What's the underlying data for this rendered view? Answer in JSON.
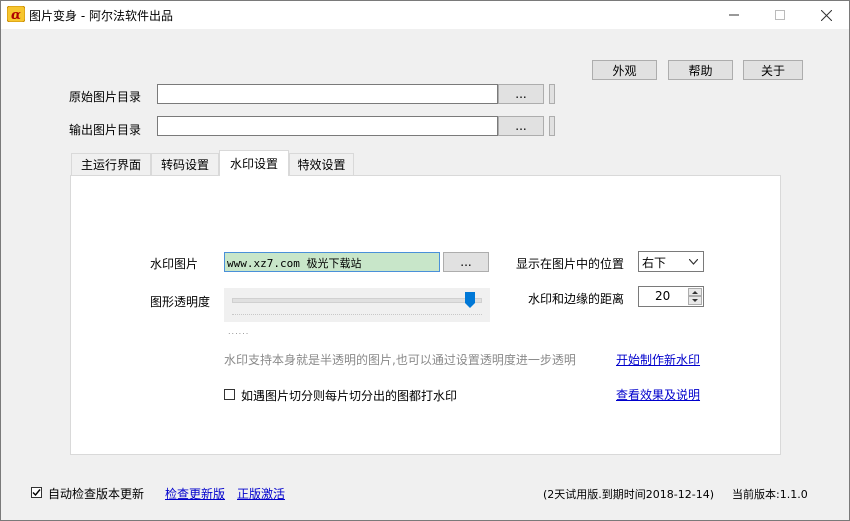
{
  "window": {
    "title": "图片变身 - 阿尔法软件出品"
  },
  "toolbar": {
    "appearance_label": "外观",
    "help_label": "帮助",
    "about_label": "关于"
  },
  "paths": {
    "source_label": "原始图片目录",
    "source_value": "",
    "source_browse": "...",
    "output_label": "输出图片目录",
    "output_value": "",
    "output_browse": "..."
  },
  "tabs": [
    {
      "label": "主运行界面"
    },
    {
      "label": "转码设置"
    },
    {
      "label": "水印设置",
      "active": true
    },
    {
      "label": "特效设置"
    }
  ],
  "watermark": {
    "image_label": "水印图片",
    "image_value": "www.xz7.com 极光下载站",
    "image_browse": "...",
    "opacity_label": "图形透明度",
    "opacity_level": 0.97,
    "slider_dots": "......",
    "position_label": "显示在图片中的位置",
    "position_value": "右下",
    "margin_label": "水印和边缘的距离",
    "margin_value": "20",
    "hint": "水印支持本身就是半透明的图片,也可以通过设置透明度进一步透明",
    "create_link": "开始制作新水印",
    "split_label": "如遇图片切分则每片切分出的图都打水印",
    "split_checked": false,
    "preview_link": "查看效果及说明"
  },
  "footer": {
    "auto_check_label": "自动检查版本更新",
    "auto_check_checked": true,
    "check_link": "检查更新版",
    "activate_link": "正版激活",
    "trial_text": "(2天试用版.到期时间2018-12-14)",
    "version_text": "当前版本:1.1.0"
  },
  "colors": {
    "link": "#0000cc",
    "slider_thumb": "#0078d7",
    "watermark_field": "#c8e6c9",
    "panel_bg": "#ffffff",
    "window_bg": "#f0f0f0"
  }
}
